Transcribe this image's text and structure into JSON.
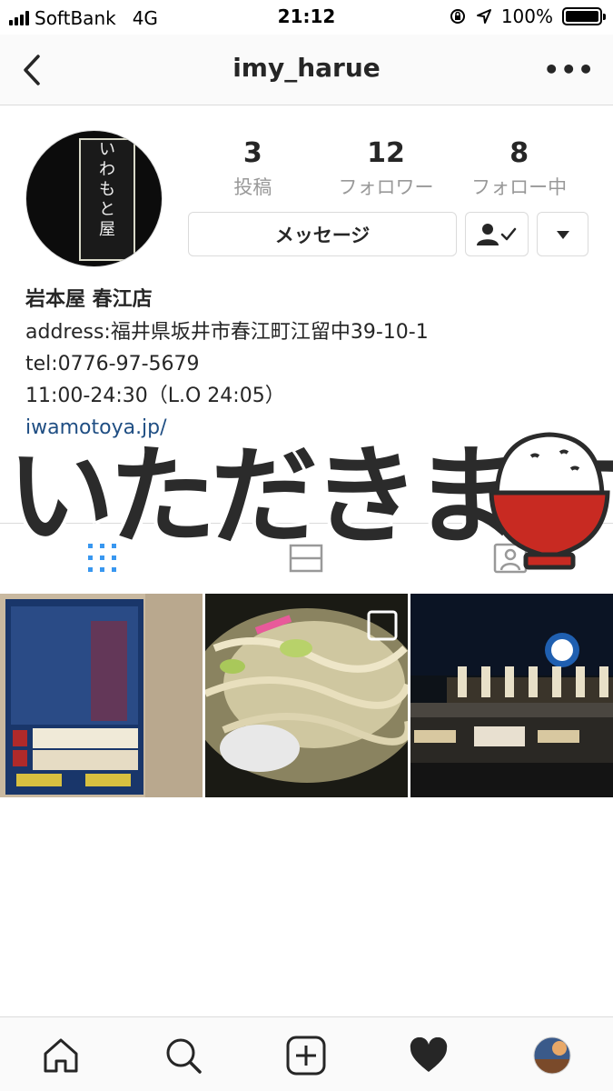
{
  "status_bar": {
    "carrier": "SoftBank",
    "network": "4G",
    "time": "21:12",
    "battery": "100%"
  },
  "header": {
    "username": "imy_harue",
    "back_icon": "chevron-left-icon",
    "more_icon": "ellipsis-icon"
  },
  "profile": {
    "avatar_sign": [
      "い",
      "わ",
      "も",
      "と",
      "屋"
    ],
    "stats": [
      {
        "value": "3",
        "label": "投稿"
      },
      {
        "value": "12",
        "label": "フォロワー"
      },
      {
        "value": "8",
        "label": "フォロー中"
      }
    ],
    "message_label": "メッセージ",
    "name": "岩本屋 春江店",
    "bio_lines": [
      "address:福井県坂井市春江町江留中39-10-1",
      "tel:0776-97-5679",
      "11:00-24:30（L.O 24:05）"
    ],
    "link": "iwamotoya.jp/"
  },
  "sticker": {
    "text": "いただきます"
  },
  "tabs": [
    "grid-icon",
    "list-icon",
    "tagged-icon"
  ],
  "grid_posts": [
    {
      "name": "post-poster",
      "color": "#1b3a6e"
    },
    {
      "name": "post-ramen",
      "color": "#6b6548"
    },
    {
      "name": "post-storefront",
      "color": "#0f1216"
    }
  ],
  "tabbar": [
    "home-icon",
    "search-icon",
    "new-post-icon",
    "activity-heart-icon",
    "profile-avatar-icon"
  ],
  "colors": {
    "link": "#1f4e83",
    "accent_blue": "#3897f0",
    "bowl_red": "#c82a22"
  }
}
